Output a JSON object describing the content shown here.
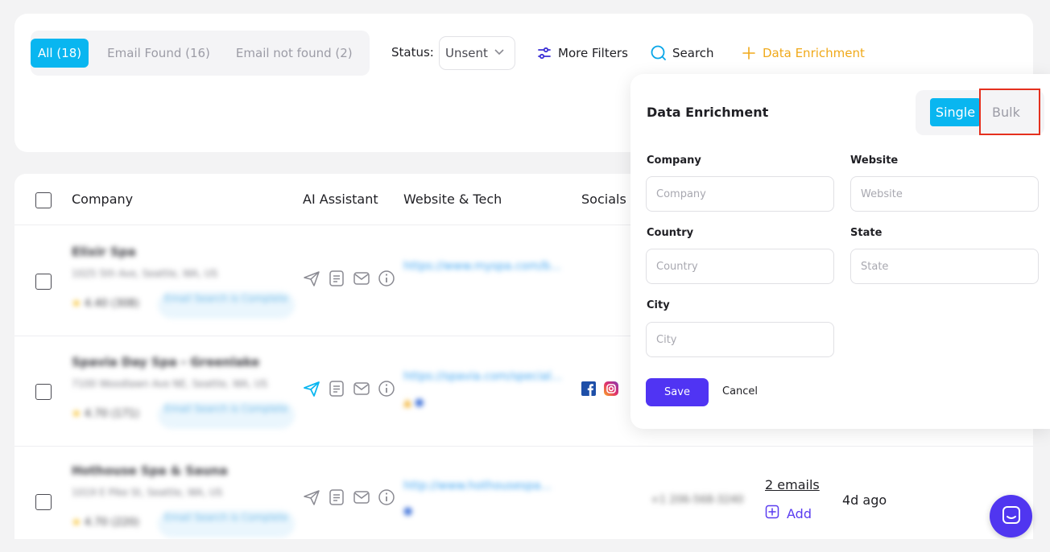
{
  "filters": {
    "tabs": [
      {
        "label": "All (18)",
        "active": true
      },
      {
        "label": "Email Found (16)",
        "active": false
      },
      {
        "label": "Email not found (2)",
        "active": false
      }
    ],
    "status_label": "Status:",
    "status_value": "Unsent",
    "more_filters": "More Filters",
    "search": "Search",
    "data_enrichment": "Data Enrichment"
  },
  "table": {
    "headers": {
      "company": "Company",
      "ai_assistant": "AI Assistant",
      "website_tech": "Website & Tech",
      "socials": "Socials"
    },
    "rows": [
      {
        "name": "Elixir Spa",
        "address": "1025 5th Ave, Seattle, WA, US",
        "rating": "4.40 (308)",
        "pill": "Email Search is Complete",
        "website": "https://www.myspa.com/b...",
        "emails": "",
        "add": "",
        "ago": ""
      },
      {
        "name": "Spavia Day Spa - Greenlake",
        "address": "7100 Woodlawn Ave NE, Seattle, WA, US",
        "rating": "4.70 (171)",
        "pill": "Email Search is Complete",
        "website": "https://spavia.com/special...",
        "emails": "",
        "add": "",
        "ago": ""
      },
      {
        "name": "Hothouse Spa & Sauna",
        "address": "1019 E Pike St, Seattle, WA, US",
        "rating": "4.70 (220)",
        "pill": "Email Search is Complete",
        "website": "http://www.hothousespa...",
        "phone": "+1 206-568-3240",
        "emails": "2 emails",
        "add": "Add",
        "ago": "4d ago"
      }
    ]
  },
  "panel": {
    "title": "Data Enrichment",
    "mode_single": "Single",
    "mode_bulk": "Bulk",
    "fields": {
      "company_label": "Company",
      "company_placeholder": "Company",
      "website_label": "Website",
      "website_placeholder": "Website",
      "country_label": "Country",
      "country_placeholder": "Country",
      "state_label": "State",
      "state_placeholder": "State",
      "city_label": "City",
      "city_placeholder": "City"
    },
    "save": "Save",
    "cancel": "Cancel"
  },
  "colors": {
    "accent_blue": "#09b6f0",
    "primary_purple": "#5034f3",
    "enrichment_orange": "#f0a91a",
    "highlight_red": "#e5301e"
  }
}
